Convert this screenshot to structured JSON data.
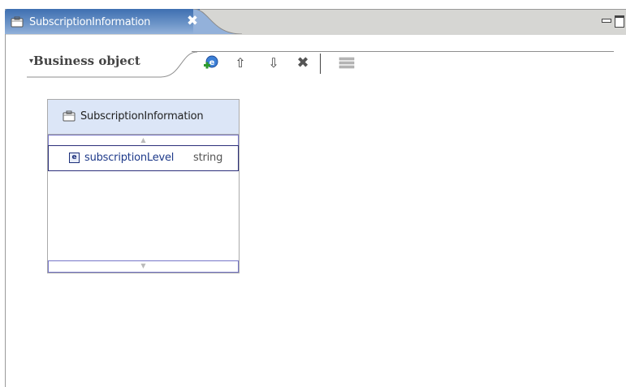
{
  "editor_tab": {
    "title": "SubscriptionInformation",
    "close_glyph": "✖",
    "icon": "business-object-icon"
  },
  "window_controls": {
    "minimize_icon": "minimize-icon",
    "maximize_icon": "maximize-icon"
  },
  "section": {
    "twisty": "▾",
    "title": "Business object"
  },
  "toolbar": {
    "items": [
      {
        "name": "add-field-icon"
      },
      {
        "name": "move-up-icon",
        "glyph": "⇧"
      },
      {
        "name": "move-down-icon",
        "glyph": "⇩"
      },
      {
        "name": "delete-icon",
        "glyph": "✖"
      },
      {
        "name": "layout-icon"
      }
    ]
  },
  "business_object": {
    "name": "SubscriptionInformation",
    "scroll_up_glyph": "▲",
    "scroll_down_glyph": "▼",
    "attributes": [
      {
        "icon_letter": "e",
        "name": "subscriptionLevel",
        "type": "string"
      }
    ]
  },
  "colors": {
    "tab_active": "#5a86c0",
    "header_fill": "#dce6f7",
    "selection_border": "#2b2f7a"
  }
}
